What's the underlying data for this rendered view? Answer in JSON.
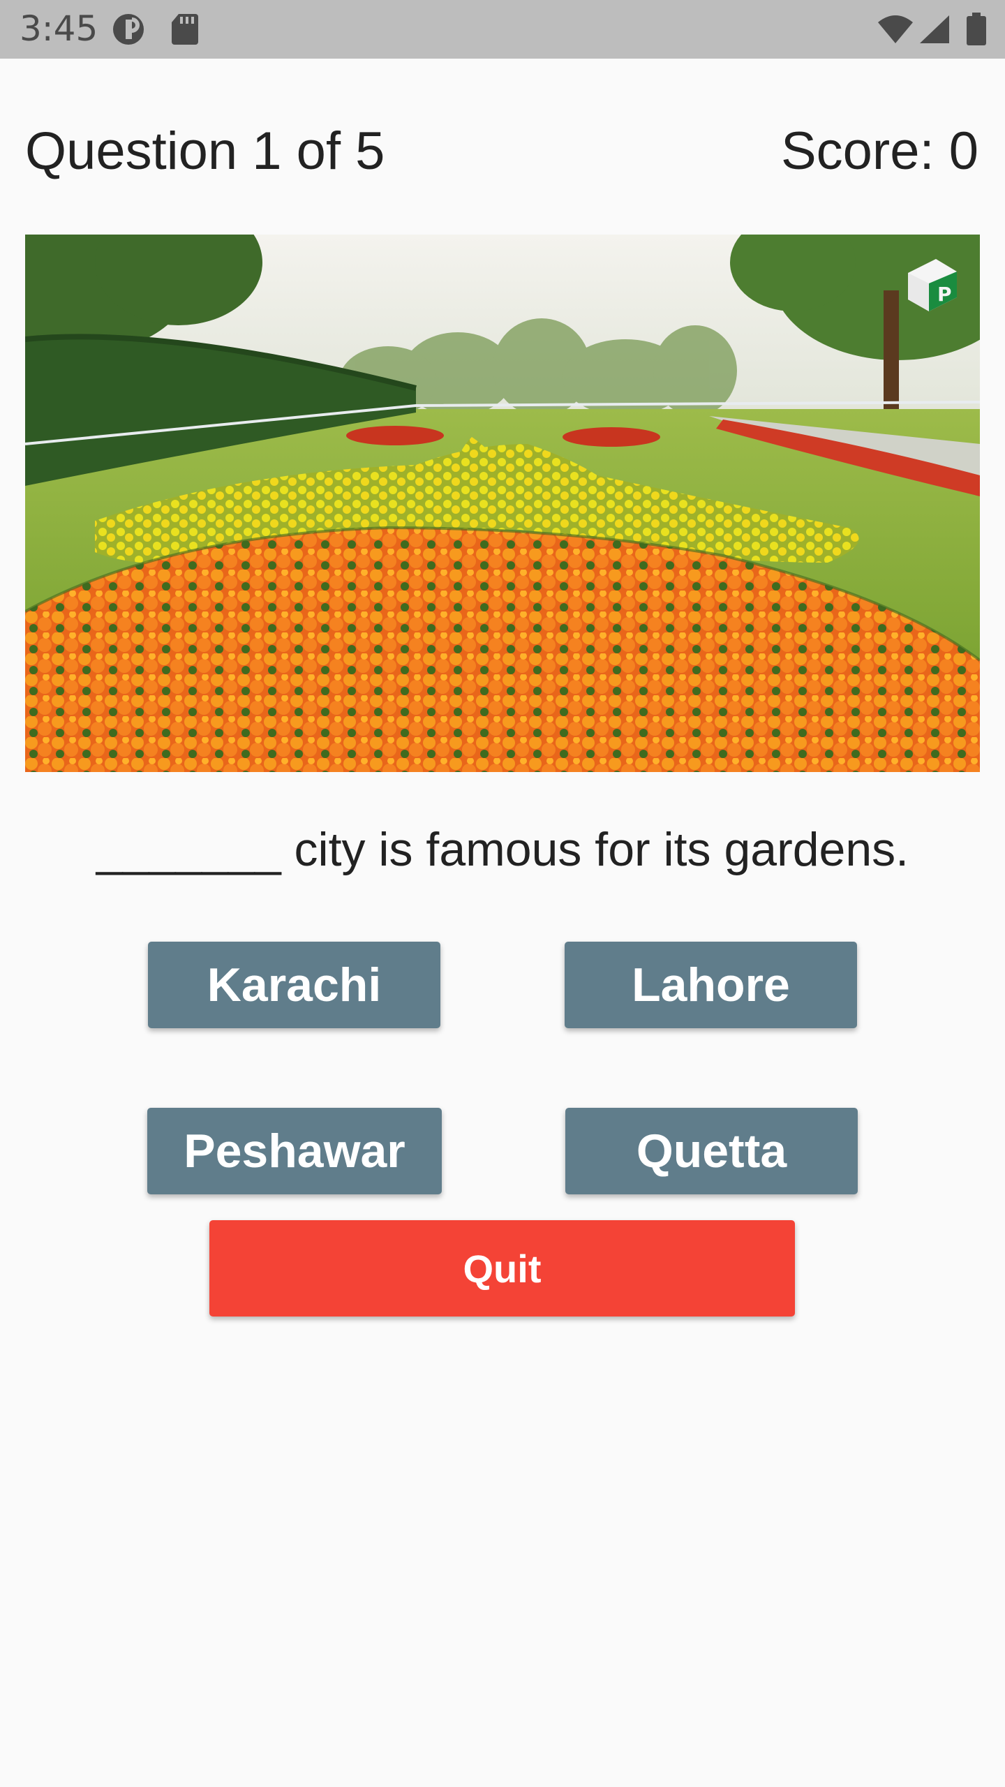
{
  "status_bar": {
    "time": "3:45",
    "icons": [
      "app-notification-icon",
      "sd-card-icon",
      "wifi-icon",
      "cell-signal-icon",
      "battery-icon"
    ],
    "background_color": "#bdbdbd"
  },
  "header": {
    "question_counter": "Question 1 of 5",
    "score": "Score: 0"
  },
  "image": {
    "description_icon": "garden-photo",
    "alt": "Garden with marigold flower beds"
  },
  "question": {
    "text": "_______ city is famous for its gardens."
  },
  "options": [
    {
      "label": "Karachi"
    },
    {
      "label": "Lahore"
    },
    {
      "label": "Peshawar"
    },
    {
      "label": "Quetta"
    }
  ],
  "quit": {
    "label": "Quit"
  },
  "colors": {
    "option_button": "#607d8b",
    "quit_button": "#f44336",
    "background": "#fafafa"
  }
}
